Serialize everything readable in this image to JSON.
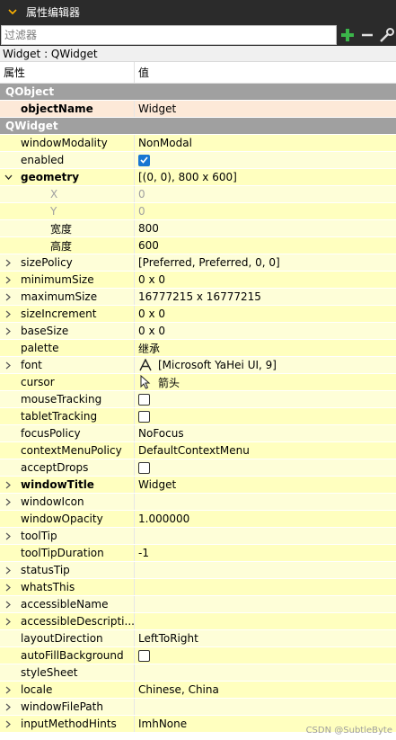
{
  "window": {
    "title": "属性编辑器"
  },
  "filter": {
    "placeholder": "过滤器",
    "value": ""
  },
  "object_line": "Widget : QWidget",
  "header": {
    "col_property": "属性",
    "col_value": "值"
  },
  "rows": [
    {
      "type": "group",
      "name": "QObject"
    },
    {
      "name": "objectName",
      "value": "Widget",
      "bold": true,
      "selected": true
    },
    {
      "type": "group",
      "name": "QWidget"
    },
    {
      "name": "windowModality",
      "value": "NonModal"
    },
    {
      "name": "enabled",
      "checkbox": true,
      "checked": true
    },
    {
      "name": "geometry",
      "value": "[(0, 0), 800 x 600]",
      "bold": true,
      "expander": "expanded"
    },
    {
      "name": "X",
      "value": "0",
      "child": true,
      "disabled": true
    },
    {
      "name": "Y",
      "value": "0",
      "child": true,
      "disabled": true
    },
    {
      "name": "宽度",
      "value": "800",
      "child": true
    },
    {
      "name": "高度",
      "value": "600",
      "child": true
    },
    {
      "name": "sizePolicy",
      "value": "[Preferred, Preferred, 0, 0]",
      "expander": "collapsed"
    },
    {
      "name": "minimumSize",
      "value": "0 x 0",
      "expander": "collapsed"
    },
    {
      "name": "maximumSize",
      "value": "16777215 x 16777215",
      "expander": "collapsed"
    },
    {
      "name": "sizeIncrement",
      "value": "0 x 0",
      "expander": "collapsed"
    },
    {
      "name": "baseSize",
      "value": "0 x 0",
      "expander": "collapsed"
    },
    {
      "name": "palette",
      "value": "继承"
    },
    {
      "name": "font",
      "value": "[Microsoft YaHei UI, 9]",
      "expander": "collapsed",
      "icon": "font-icon"
    },
    {
      "name": "cursor",
      "value": "箭头",
      "icon": "arrow-cursor-icon"
    },
    {
      "name": "mouseTracking",
      "checkbox": true,
      "checked": false
    },
    {
      "name": "tabletTracking",
      "checkbox": true,
      "checked": false
    },
    {
      "name": "focusPolicy",
      "value": "NoFocus"
    },
    {
      "name": "contextMenuPolicy",
      "value": "DefaultContextMenu"
    },
    {
      "name": "acceptDrops",
      "checkbox": true,
      "checked": false
    },
    {
      "name": "windowTitle",
      "value": "Widget",
      "bold": true,
      "expander": "collapsed"
    },
    {
      "name": "windowIcon",
      "value": "",
      "expander": "collapsed"
    },
    {
      "name": "windowOpacity",
      "value": "1.000000"
    },
    {
      "name": "toolTip",
      "value": "",
      "expander": "collapsed"
    },
    {
      "name": "toolTipDuration",
      "value": "-1"
    },
    {
      "name": "statusTip",
      "value": "",
      "expander": "collapsed"
    },
    {
      "name": "whatsThis",
      "value": "",
      "expander": "collapsed"
    },
    {
      "name": "accessibleName",
      "value": "",
      "expander": "collapsed"
    },
    {
      "name": "accessibleDescripti...",
      "value": "",
      "expander": "collapsed"
    },
    {
      "name": "layoutDirection",
      "value": "LeftToRight"
    },
    {
      "name": "autoFillBackground",
      "checkbox": true,
      "checked": false
    },
    {
      "name": "styleSheet",
      "value": ""
    },
    {
      "name": "locale",
      "value": "Chinese, China",
      "expander": "collapsed"
    },
    {
      "name": "windowFilePath",
      "value": "",
      "expander": "collapsed"
    },
    {
      "name": "inputMethodHints",
      "value": "ImhNone",
      "expander": "collapsed"
    }
  ],
  "watermark": "CSDN @SubtleByte",
  "colors": {
    "group_bg": "#a0a0a0",
    "row_yellow": "#ffffbf",
    "selected_row": "#fde9d8",
    "titlebar_bg": "#2b2b2b",
    "add_icon": "#3bb54a"
  }
}
